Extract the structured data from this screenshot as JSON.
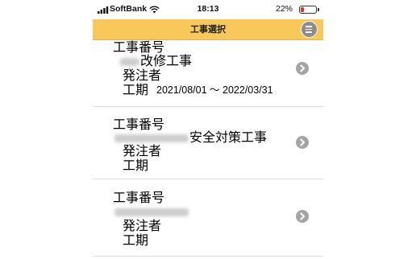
{
  "status_bar": {
    "carrier": "SoftBank",
    "time": "18:13",
    "battery_percent": "22%",
    "battery_level": 0.22,
    "icons": [
      "signal-icon",
      "wifi-icon",
      "battery-icon"
    ]
  },
  "header": {
    "title": "工事選択",
    "menu_icon": "hamburger-menu-icon",
    "color": "#f8c85a"
  },
  "list": {
    "items": [
      {
        "label_no": "工事番号",
        "name_visible": "改修工事",
        "label_orderer": "発注者",
        "label_period": "工期",
        "period": "2021/08/01 ～ 2022/03/31"
      },
      {
        "label_no": "工事番号",
        "name_visible": "安全対策工事",
        "label_orderer": "発注者",
        "label_period": "工期",
        "period": ""
      },
      {
        "label_no": "工事番号",
        "name_visible": "",
        "label_orderer": "発注者",
        "label_period": "工期",
        "period": ""
      }
    ],
    "chevron_icon": "chevron-right-icon"
  }
}
